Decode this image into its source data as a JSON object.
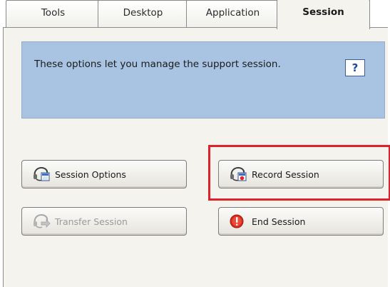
{
  "tabs": [
    {
      "label": "Tools",
      "active": false
    },
    {
      "label": "Desktop",
      "active": false
    },
    {
      "label": "Application",
      "active": false
    },
    {
      "label": "Session",
      "active": true
    }
  ],
  "info": {
    "text": "These options let you manage the support session.",
    "help_label": "?"
  },
  "buttons": {
    "session_options": "Session Options",
    "record_session": "Record Session",
    "transfer_session": "Transfer Session",
    "end_session": "End Session"
  },
  "colors": {
    "info_background": "#a9c4e2",
    "highlight_border": "#e0202a",
    "panel_background": "#f4f3ee"
  },
  "icons": {
    "session_options": "headset-icon",
    "record_session": "headset-record-icon",
    "transfer_session": "headset-transfer-icon",
    "end_session": "end-session-icon"
  },
  "state": {
    "transfer_session_enabled": false,
    "highlighted_button": "record_session"
  }
}
